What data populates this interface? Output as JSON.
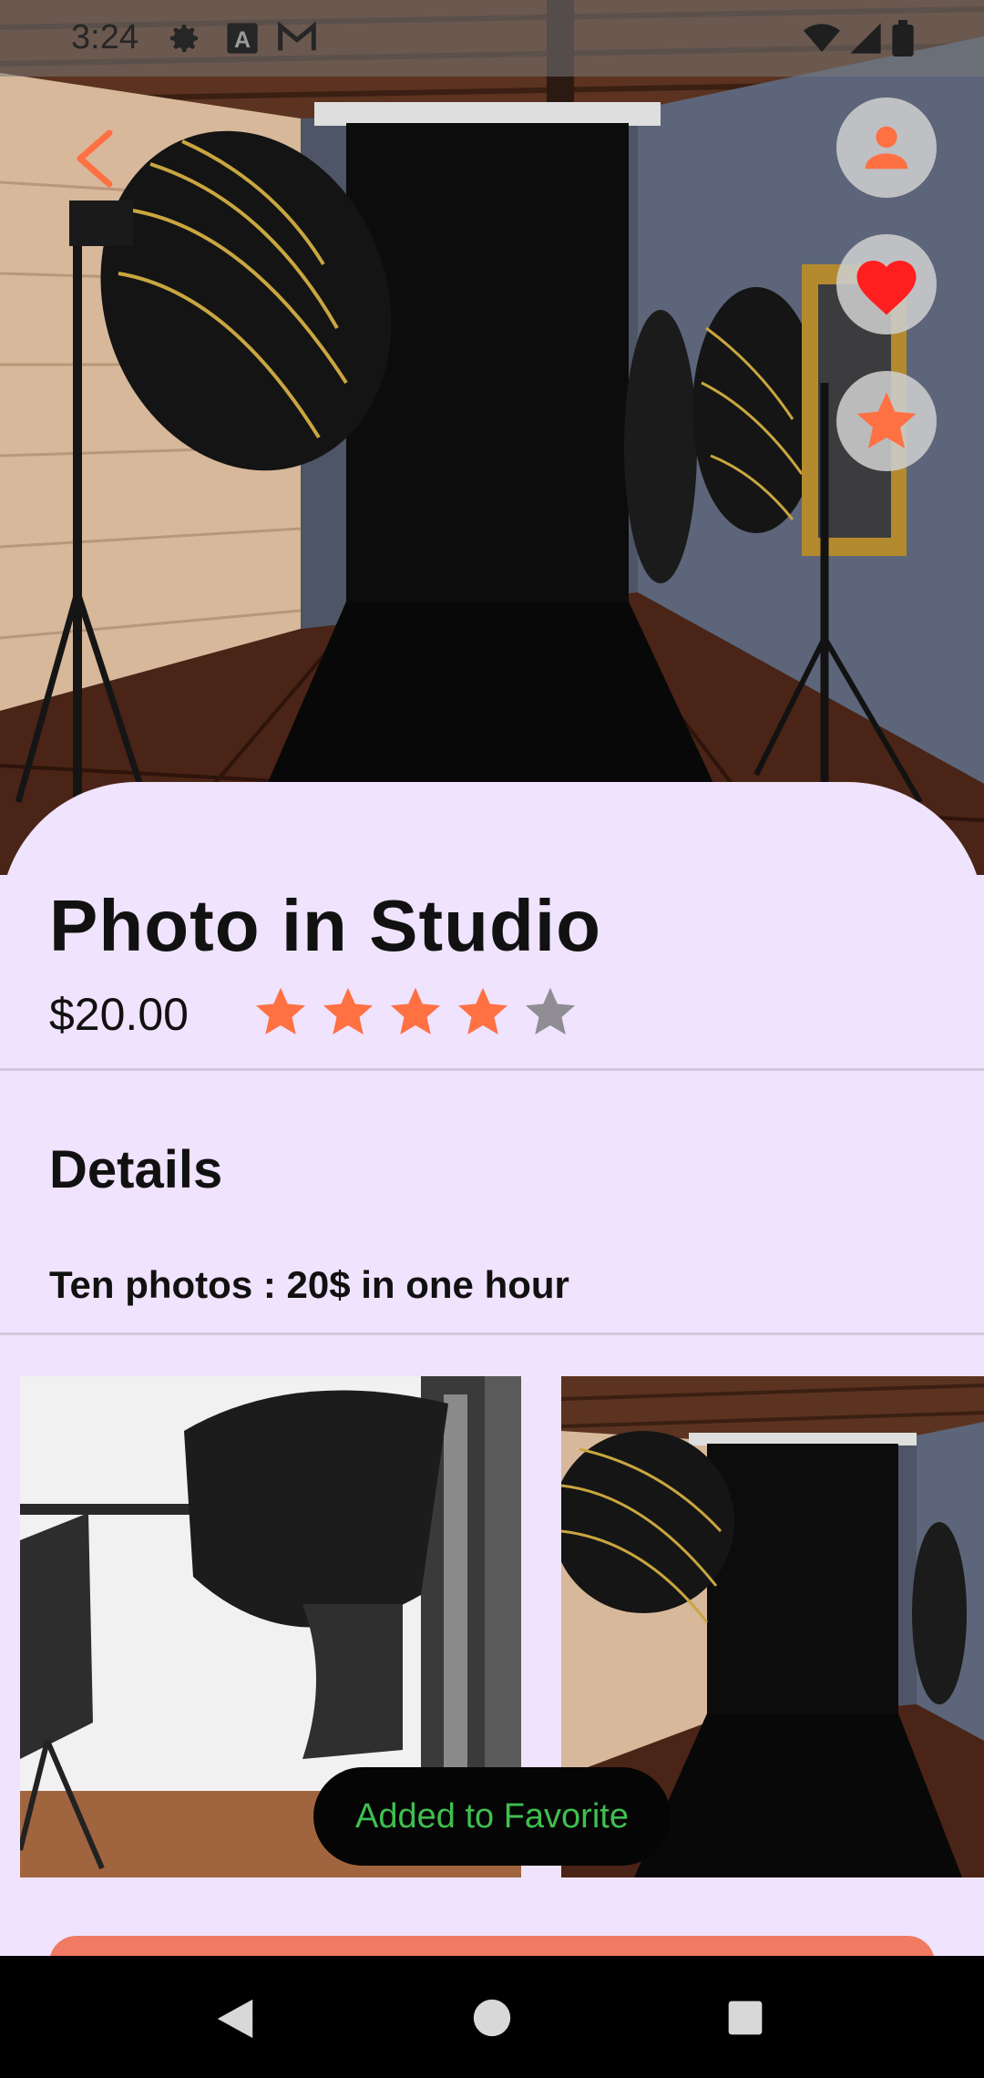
{
  "status_bar": {
    "time": "3:24",
    "icons_left": [
      "gear-icon",
      "a-icon",
      "m-icon"
    ],
    "icons_right": [
      "wifi-icon",
      "signal-icon",
      "battery-icon"
    ]
  },
  "header": {
    "back_icon": "chevron-left-icon",
    "actions": [
      "profile-icon",
      "heart-icon",
      "star-icon"
    ]
  },
  "product": {
    "title": "Photo in Studio",
    "price": "$20.00",
    "rating": 4,
    "rating_max": 5
  },
  "details": {
    "heading": "Details",
    "text": "Ten photos : 20$ in one hour"
  },
  "gallery": {
    "count_visible": 2
  },
  "toast": {
    "message": "Added to Favorite"
  },
  "colors": {
    "accent": "#ff7043",
    "sheet_bg": "#efe3fd",
    "star_off": "#8f8c94",
    "toast_text": "#3fbf4f",
    "button": "#f07a62"
  },
  "nav": {
    "buttons": [
      "back-triangle-icon",
      "home-circle-icon",
      "recents-square-icon"
    ]
  }
}
